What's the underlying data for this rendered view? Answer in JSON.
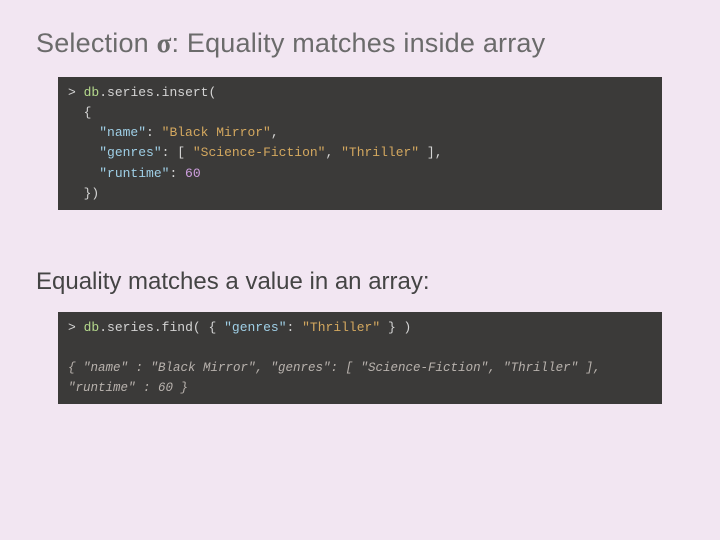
{
  "title_prefix": "Selection ",
  "title_sigma": "σ",
  "title_suffix": ": Equality matches inside array",
  "subtitle": "Equality matches a value in an array:",
  "code1": {
    "prompt": ">",
    "db": "db",
    "dot1": ".",
    "coll": "series",
    "dot2": ".",
    "method": "insert(",
    "brace_open": "{",
    "k_name": "\"name\"",
    "colon1": ": ",
    "v_name": "\"Black Mirror\"",
    "comma1": ",",
    "k_genres": "\"genres\"",
    "colon2": ": ",
    "bracket_open": "[ ",
    "v_genre1": "\"Science-Fiction\"",
    "comma_g": ", ",
    "v_genre2": "\"Thriller\"",
    "bracket_close": " ],",
    "k_runtime": "\"runtime\"",
    "colon3": ": ",
    "v_runtime": "60",
    "brace_close": "})"
  },
  "code2": {
    "prompt": ">",
    "db": "db",
    "dot1": ".",
    "coll": "series",
    "dot2": ".",
    "method": "find( ",
    "brace_open": "{ ",
    "k_genres": "\"genres\"",
    "colon": ": ",
    "v_genre": "\"Thriller\"",
    "brace_close": " } )"
  },
  "result": "{ \"name\" : \"Black Mirror\", \"genres\": [ \"Science-Fiction\", \"Thriller\" ],\n\"runtime\" : 60 }"
}
